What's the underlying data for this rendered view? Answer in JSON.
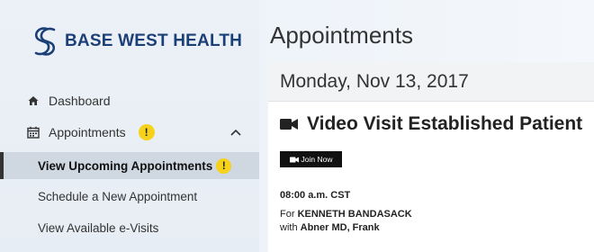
{
  "brand": {
    "name": "BASE WEST HEALTH",
    "color": "#1b3f77"
  },
  "sidebar": {
    "dashboard": {
      "label": "Dashboard",
      "icon": "home-icon"
    },
    "appointments": {
      "label": "Appointments",
      "icon": "calendar-icon",
      "badge": "!",
      "expanded": true
    },
    "sub_items": [
      {
        "label": "View Upcoming Appointments",
        "active": true,
        "badge": "!"
      },
      {
        "label": "Schedule a New Appointment"
      },
      {
        "label": "View Available e-Visits"
      }
    ]
  },
  "main": {
    "title": "Appointments",
    "date": "Monday, Nov 13, 2017",
    "visit": {
      "title": "Video Visit Established Patient",
      "join_label": "Join Now",
      "time": "08:00 a.m. CST",
      "for_prefix": "For",
      "patient": "KENNETH BANDASACK",
      "with_prefix": "with",
      "provider": "Abner MD, Frank"
    }
  },
  "colors": {
    "badge": "#f6d21a",
    "active_bg": "#cfd7e1"
  }
}
